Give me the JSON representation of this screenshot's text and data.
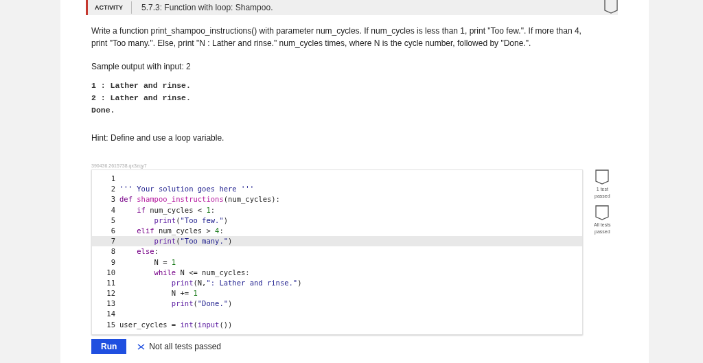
{
  "header": {
    "label": "ACTIVITY",
    "title": "5.7.3: Function with loop: Shampoo.",
    "completed": false
  },
  "instructions": "Write a function print_shampoo_instructions() with parameter num_cycles. If num_cycles is less than 1, print \"Too few.\". If more than 4, print \"Too many.\". Else, print \"N : Lather and rinse.\" num_cycles times, where N is the cycle number, followed by \"Done.\".",
  "sample_label": "Sample output with input: 2",
  "sample_output": [
    "1 : Lather and rinse.",
    "2 : Lather and rinse.",
    "Done."
  ],
  "hint": "Hint: Define and use a loop variable.",
  "exercise_id": "390436.2615738.qx3zqy7",
  "editor": {
    "lines": [
      {
        "number": "1",
        "active": false
      },
      {
        "number": "2",
        "active": false,
        "tokens": [
          {
            "text": "''' Your solution goes here '''",
            "kind": "string"
          }
        ]
      },
      {
        "number": "3",
        "active": false,
        "tokens": [
          {
            "text": "def ",
            "kind": "keyword"
          },
          {
            "text": "shampoo_instructions",
            "kind": "def"
          },
          {
            "text": "(num_cycles):",
            "kind": "plain"
          }
        ]
      },
      {
        "number": "4",
        "active": false,
        "tokens": [
          {
            "text": "    if ",
            "kind": "keyword"
          },
          {
            "text": "num_cycles < ",
            "kind": "plain"
          },
          {
            "text": "1",
            "kind": "number"
          },
          {
            "text": ":",
            "kind": "plain"
          }
        ]
      },
      {
        "number": "5",
        "active": false,
        "tokens": [
          {
            "text": "        print",
            "kind": "builtin"
          },
          {
            "text": "(",
            "kind": "plain"
          },
          {
            "text": "\"Too few.\"",
            "kind": "string"
          },
          {
            "text": ")",
            "kind": "plain"
          }
        ]
      },
      {
        "number": "6",
        "active": false,
        "tokens": [
          {
            "text": "    elif ",
            "kind": "keyword"
          },
          {
            "text": "num_cycles > ",
            "kind": "plain"
          },
          {
            "text": "4",
            "kind": "number"
          },
          {
            "text": ":",
            "kind": "plain"
          }
        ]
      },
      {
        "number": "7",
        "active": true,
        "tokens": [
          {
            "text": "        print",
            "kind": "builtin"
          },
          {
            "text": "(",
            "kind": "plain"
          },
          {
            "text": "\"Too many.\"",
            "kind": "string"
          },
          {
            "text": ")",
            "kind": "plain"
          }
        ]
      },
      {
        "number": "8",
        "active": false,
        "tokens": [
          {
            "text": "    else",
            "kind": "keyword"
          },
          {
            "text": ":",
            "kind": "plain"
          }
        ]
      },
      {
        "number": "9",
        "active": false,
        "tokens": [
          {
            "text": "        N = ",
            "kind": "plain"
          },
          {
            "text": "1",
            "kind": "number"
          }
        ]
      },
      {
        "number": "10",
        "active": false,
        "tokens": [
          {
            "text": "        while ",
            "kind": "keyword"
          },
          {
            "text": "N <= num_cycles:",
            "kind": "plain"
          }
        ]
      },
      {
        "number": "11",
        "active": false,
        "tokens": [
          {
            "text": "            print",
            "kind": "builtin"
          },
          {
            "text": "(N,",
            "kind": "plain"
          },
          {
            "text": "\": Lather and rinse.\"",
            "kind": "string"
          },
          {
            "text": ")",
            "kind": "plain"
          }
        ]
      },
      {
        "number": "12",
        "active": false,
        "tokens": [
          {
            "text": "            N += ",
            "kind": "plain"
          },
          {
            "text": "1",
            "kind": "number"
          }
        ]
      },
      {
        "number": "13",
        "active": false,
        "tokens": [
          {
            "text": "            print",
            "kind": "builtin"
          },
          {
            "text": "(",
            "kind": "plain"
          },
          {
            "text": "\"Done.\"",
            "kind": "string"
          },
          {
            "text": ")",
            "kind": "plain"
          }
        ]
      },
      {
        "number": "14",
        "active": false
      },
      {
        "number": "15",
        "active": false,
        "tokens": [
          {
            "text": "user_cycles = ",
            "kind": "plain"
          },
          {
            "text": "int",
            "kind": "builtin"
          },
          {
            "text": "(",
            "kind": "plain"
          },
          {
            "text": "input",
            "kind": "builtin"
          },
          {
            "text": "())",
            "kind": "plain"
          }
        ]
      }
    ]
  },
  "tests": [
    {
      "label": "1 test passed",
      "achieved": false
    },
    {
      "label": "All tests passed",
      "achieved": false
    }
  ],
  "run_button": "Run",
  "result": {
    "text": "Not all tests passed",
    "passed": false
  }
}
